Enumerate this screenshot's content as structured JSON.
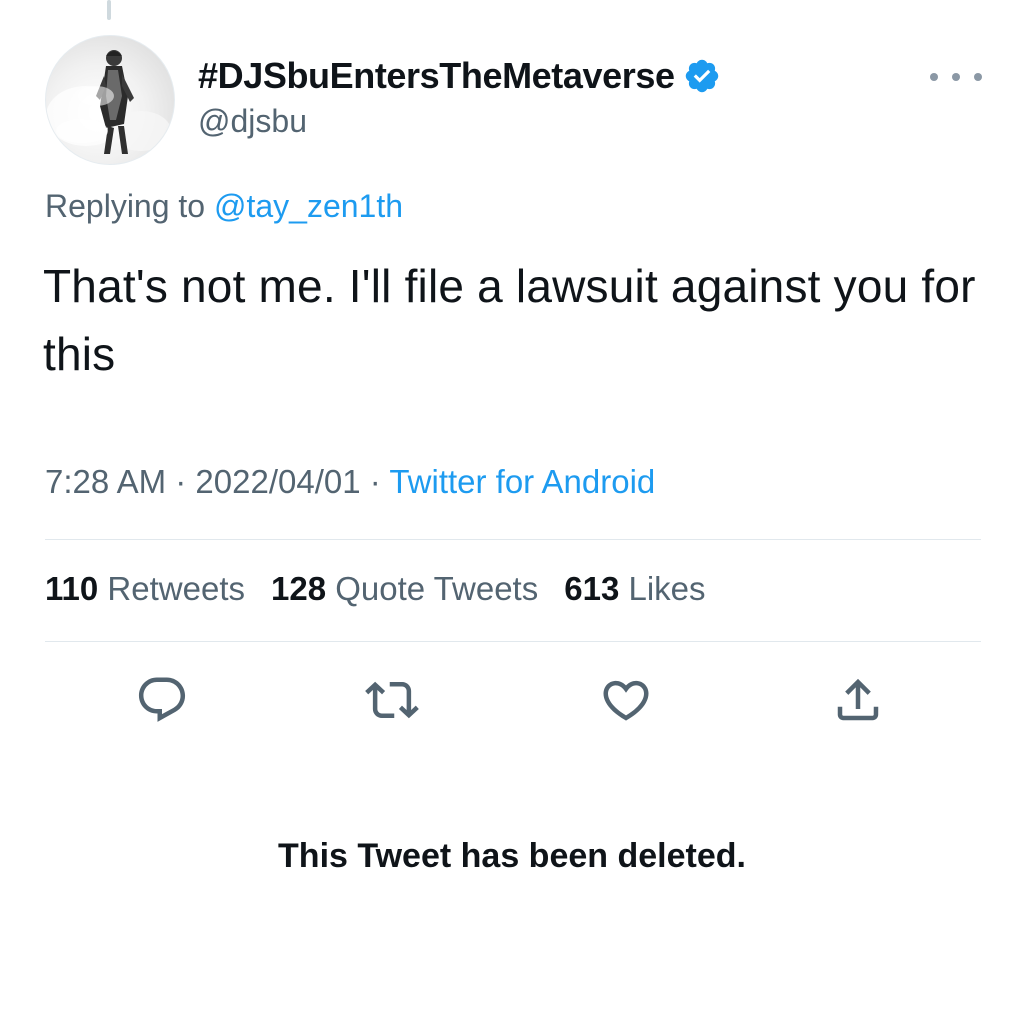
{
  "tweet": {
    "display_name": "#DJSbuEntersTheMetaverse",
    "handle": "@djsbu",
    "replying_prefix": "Replying to",
    "replying_handle": "@tay_zen1th",
    "text": "That's not me. I'll file a lawsuit against you for this",
    "time": "7:28 AM",
    "separator": " · ",
    "date": "2022/04/01",
    "source": "Twitter for Android"
  },
  "stats": {
    "retweets_count": "110",
    "retweets_label": "Retweets",
    "quotes_count": "128",
    "quotes_label": "Quote Tweets",
    "likes_count": "613",
    "likes_label": "Likes"
  },
  "icons": {
    "verified": "verified-badge-icon",
    "more": "more-horizontal-icon",
    "reply": "reply-icon",
    "retweet": "retweet-icon",
    "like": "heart-icon",
    "share": "share-icon"
  },
  "colors": {
    "accent": "#1d9bf0",
    "secondary_text": "#536471",
    "primary_text": "#0f1419"
  },
  "deleted_notice": "This Tweet has been deleted."
}
